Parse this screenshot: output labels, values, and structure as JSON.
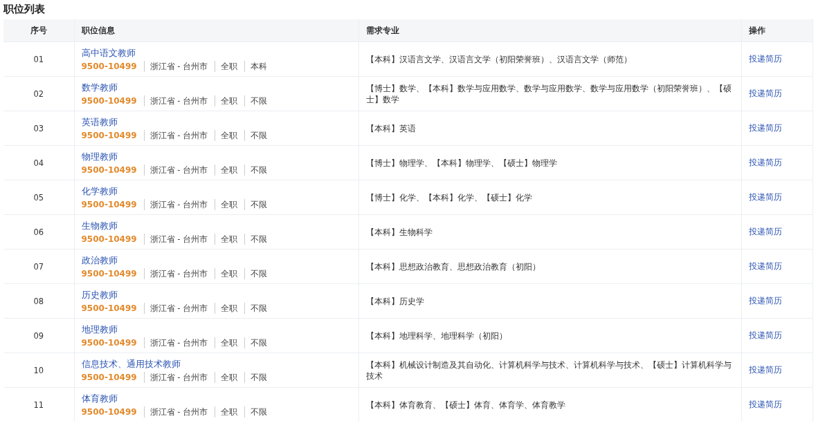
{
  "title": "职位列表",
  "table": {
    "columns": [
      "序号",
      "职位信息",
      "需求专业",
      "操作"
    ],
    "rows": [
      {
        "index": "01",
        "position": "高中语文教师",
        "salary": "9500-10499",
        "location": "浙江省 - 台州市",
        "type": "全职",
        "education": "本科",
        "majors": "【本科】汉语言文学、汉语言文学（初阳荣誉班）、汉语言文学（师范）",
        "action": "投递简历"
      },
      {
        "index": "02",
        "position": "数学教师",
        "salary": "9500-10499",
        "location": "浙江省 - 台州市",
        "type": "全职",
        "education": "不限",
        "majors": "【博士】数学、【本科】数学与应用数学、数学与应用数学、数学与应用数学（初阳荣誉班）、【硕士】数学",
        "action": "投递简历"
      },
      {
        "index": "03",
        "position": "英语教师",
        "salary": "9500-10499",
        "location": "浙江省 - 台州市",
        "type": "全职",
        "education": "不限",
        "majors": "【本科】英语",
        "action": "投递简历"
      },
      {
        "index": "04",
        "position": "物理教师",
        "salary": "9500-10499",
        "location": "浙江省 - 台州市",
        "type": "全职",
        "education": "不限",
        "majors": "【博士】物理学、【本科】物理学、【硕士】物理学",
        "action": "投递简历"
      },
      {
        "index": "05",
        "position": "化学教师",
        "salary": "9500-10499",
        "location": "浙江省 - 台州市",
        "type": "全职",
        "education": "不限",
        "majors": "【博士】化学、【本科】化学、【硕士】化学",
        "action": "投递简历"
      },
      {
        "index": "06",
        "position": "生物教师",
        "salary": "9500-10499",
        "location": "浙江省 - 台州市",
        "type": "全职",
        "education": "不限",
        "majors": "【本科】生物科学",
        "action": "投递简历"
      },
      {
        "index": "07",
        "position": "政治教师",
        "salary": "9500-10499",
        "location": "浙江省 - 台州市",
        "type": "全职",
        "education": "不限",
        "majors": "【本科】思想政治教育、思想政治教育（初阳）",
        "action": "投递简历"
      },
      {
        "index": "08",
        "position": "历史教师",
        "salary": "9500-10499",
        "location": "浙江省 - 台州市",
        "type": "全职",
        "education": "不限",
        "majors": "【本科】历史学",
        "action": "投递简历"
      },
      {
        "index": "09",
        "position": "地理教师",
        "salary": "9500-10499",
        "location": "浙江省 - 台州市",
        "type": "全职",
        "education": "不限",
        "majors": "【本科】地理科学、地理科学（初阳）",
        "action": "投递简历"
      },
      {
        "index": "10",
        "position": "信息技术、通用技术教师",
        "salary": "9500-10499",
        "location": "浙江省 - 台州市",
        "type": "全职",
        "education": "不限",
        "majors": "【本科】机械设计制造及其自动化、计算机科学与技术、计算机科学与技术、【硕士】计算机科学与技术",
        "action": "投递简历"
      },
      {
        "index": "11",
        "position": "体育教师",
        "salary": "9500-10499",
        "location": "浙江省 - 台州市",
        "type": "全职",
        "education": "不限",
        "majors": "【本科】体育教育、【硕士】体育、体育学、体育教学",
        "action": "投递简历"
      }
    ]
  }
}
